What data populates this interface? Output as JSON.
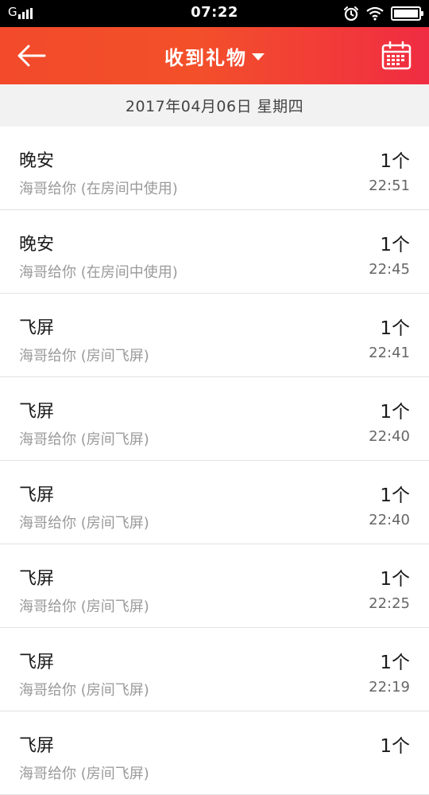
{
  "status_bar": {
    "carrier": "G",
    "time": "07:22",
    "icons": [
      "signal-icon",
      "alarm-icon",
      "wifi-icon",
      "battery-icon"
    ]
  },
  "header": {
    "title": "收到礼物",
    "back_icon": "back-arrow-icon",
    "dropdown_icon": "caret-down-icon",
    "calendar_icon": "calendar-icon",
    "colors": {
      "start": "#f24a2b",
      "end": "#f02c42"
    }
  },
  "date_bar": {
    "text": "2017年04月06日 星期四"
  },
  "gifts": [
    {
      "name": "晚安",
      "desc": "海哥给你 (在房间中使用)",
      "qty": "1个",
      "time": "22:51"
    },
    {
      "name": "晚安",
      "desc": "海哥给你 (在房间中使用)",
      "qty": "1个",
      "time": "22:45"
    },
    {
      "name": "飞屏",
      "desc": "海哥给你 (房间飞屏)",
      "qty": "1个",
      "time": "22:41"
    },
    {
      "name": "飞屏",
      "desc": "海哥给你 (房间飞屏)",
      "qty": "1个",
      "time": "22:40"
    },
    {
      "name": "飞屏",
      "desc": "海哥给你 (房间飞屏)",
      "qty": "1个",
      "time": "22:40"
    },
    {
      "name": "飞屏",
      "desc": "海哥给你 (房间飞屏)",
      "qty": "1个",
      "time": "22:25"
    },
    {
      "name": "飞屏",
      "desc": "海哥给你 (房间飞屏)",
      "qty": "1个",
      "time": "22:19"
    },
    {
      "name": "飞屏",
      "desc": "海哥给你 (房间飞屏)",
      "qty": "1个",
      "time": ""
    }
  ]
}
